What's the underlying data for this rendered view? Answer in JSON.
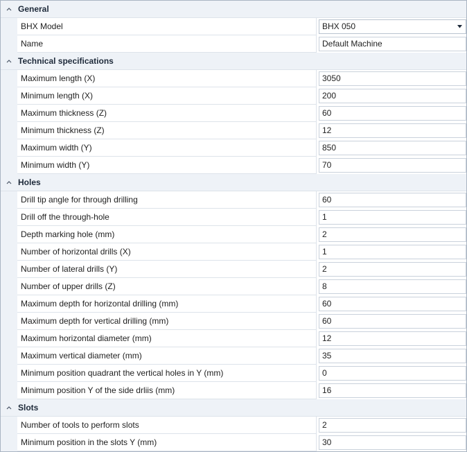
{
  "groups": [
    {
      "title": "General",
      "rows": [
        {
          "label": "BHX Model",
          "value": "BHX 050",
          "type": "select"
        },
        {
          "label": "Name",
          "value": "Default Machine",
          "type": "text"
        }
      ]
    },
    {
      "title": "Technical specifications",
      "rows": [
        {
          "label": "Maximum length (X)",
          "value": "3050",
          "type": "text"
        },
        {
          "label": "Minimum length (X)",
          "value": "200",
          "type": "text"
        },
        {
          "label": "Maximum thickness (Z)",
          "value": "60",
          "type": "text"
        },
        {
          "label": "Minimum thickness (Z)",
          "value": "12",
          "type": "text"
        },
        {
          "label": "Maximum width (Y)",
          "value": "850",
          "type": "text"
        },
        {
          "label": "Minimum width (Y)",
          "value": "70",
          "type": "text"
        }
      ]
    },
    {
      "title": "Holes",
      "rows": [
        {
          "label": "Drill tip angle for through drilling",
          "value": "60",
          "type": "text"
        },
        {
          "label": "Drill off the through-hole",
          "value": "1",
          "type": "text"
        },
        {
          "label": "Depth marking hole (mm)",
          "value": "2",
          "type": "text"
        },
        {
          "label": "Number of horizontal drills (X)",
          "value": "1",
          "type": "text"
        },
        {
          "label": "Number of lateral drills (Y)",
          "value": "2",
          "type": "text"
        },
        {
          "label": "Number of upper drills (Z)",
          "value": "8",
          "type": "text"
        },
        {
          "label": "Maximum depth for horizontal drilling (mm)",
          "value": "60",
          "type": "text"
        },
        {
          "label": "Maximum depth for vertical drilling (mm)",
          "value": "60",
          "type": "text"
        },
        {
          "label": "Maximum horizontal diameter (mm)",
          "value": "12",
          "type": "text"
        },
        {
          "label": "Maximum vertical diameter (mm)",
          "value": "35",
          "type": "text"
        },
        {
          "label": "Minimum position quadrant the vertical holes in Y (mm)",
          "value": "0",
          "type": "text"
        },
        {
          "label": "Minimum position Y of the side drliis (mm)",
          "value": "16",
          "type": "text"
        }
      ]
    },
    {
      "title": "Slots",
      "rows": [
        {
          "label": "Number of tools to perform slots",
          "value": "2",
          "type": "text"
        },
        {
          "label": "Minimum position in the slots Y (mm)",
          "value": "30",
          "type": "text"
        }
      ]
    }
  ],
  "icons": {
    "group_toggle": "chevron-up-icon",
    "select_arrow": "dropdown-arrow-icon"
  },
  "colors": {
    "category_background": "#eef2f7",
    "grid_border": "#a9b4c2",
    "cell_border": "#dde3ea"
  }
}
